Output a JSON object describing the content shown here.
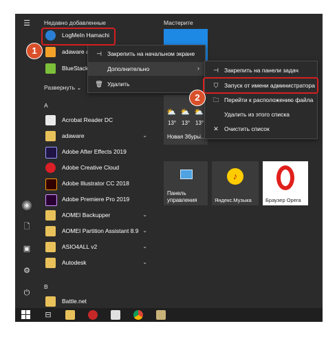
{
  "recent_header": "Недавно добавленные",
  "tiles_header": "Мастерите",
  "expand_label": "Развернуть",
  "recent_items": [
    {
      "label": "LogMeIn Hamachi"
    },
    {
      "label": "adaware a"
    },
    {
      "label": "BlueStacks"
    }
  ],
  "section_a": "A",
  "section_b": "B",
  "apps": [
    {
      "label": "Acrobat Reader DC"
    },
    {
      "label": "adaware"
    },
    {
      "label": "Adobe After Effects 2019"
    },
    {
      "label": "Adobe Creative Cloud"
    },
    {
      "label": "Adobe Illustrator CC 2018"
    },
    {
      "label": "Adobe Premiere Pro 2019"
    },
    {
      "label": "AOMEI Backupper"
    },
    {
      "label": "AOMEI Partition Assistant 8.9"
    },
    {
      "label": "ASIO4ALL v2"
    },
    {
      "label": "Autodesk"
    },
    {
      "label": "Battle.net"
    }
  ],
  "context_menu_1": {
    "pin_start": "Закрепить на начальном экране",
    "more": "Дополнительно",
    "delete": "Удалить"
  },
  "context_menu_2": {
    "pin_taskbar": "Закрепить на панели задач",
    "run_admin": "Запуск от имени администратора",
    "open_location": "Перейти к расположению файла",
    "remove_list": "Удалить из этого списка",
    "clear_list": "Очистить список"
  },
  "weather_tile": {
    "temps": [
      "13°",
      "13°",
      "13°"
    ],
    "city": "Новая Збурьі..."
  },
  "tiles": {
    "control_panel_line1": "Панель",
    "control_panel_line2": "управления",
    "yandex_music": "Яндекс.Музыка",
    "opera": "Браузер Opera"
  },
  "step_badges": {
    "one": "1",
    "two": "2"
  },
  "colors": {
    "highlight": "#d71f1f",
    "badge": "#d9502b",
    "tile_blue": "#1e88e5",
    "menu_bg": "#2b2b2b"
  }
}
